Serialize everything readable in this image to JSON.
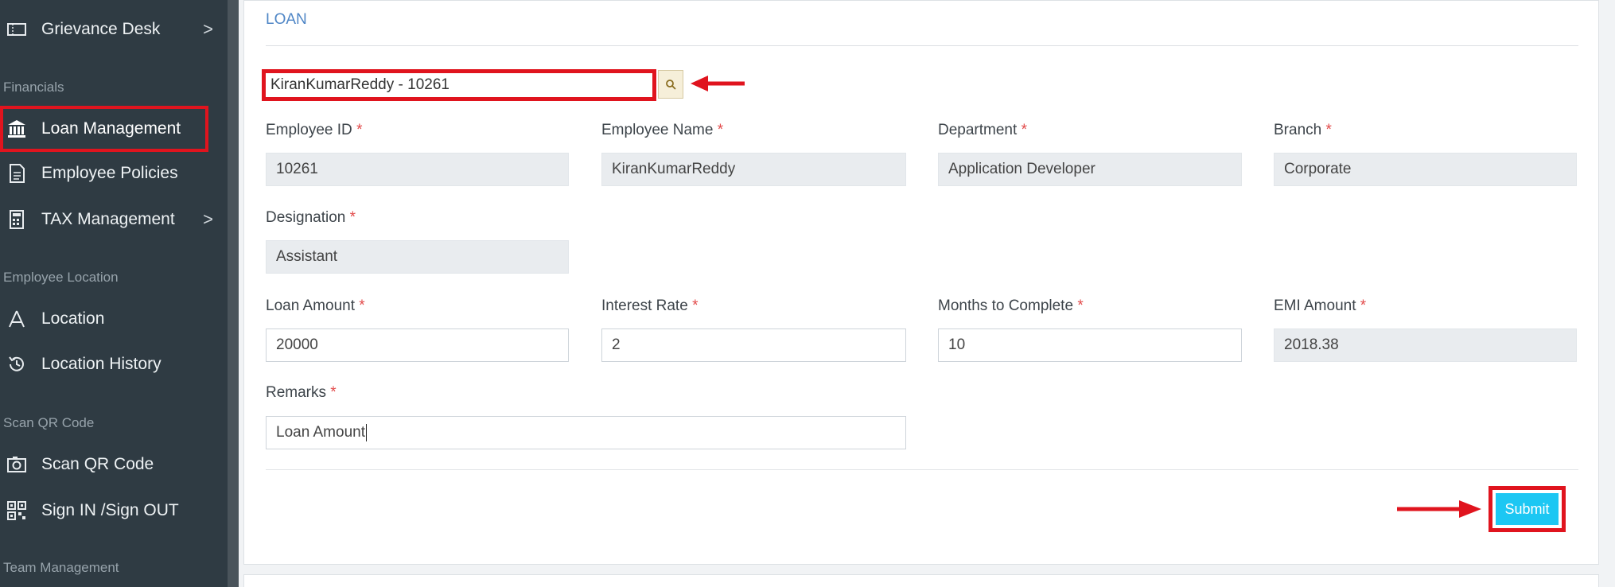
{
  "sidebar": {
    "items": [
      {
        "label": "Grievance Desk",
        "icon": "ticket-icon",
        "chevron": ">"
      },
      {
        "label": "Loan Management",
        "icon": "bank-icon"
      },
      {
        "label": "Employee Policies",
        "icon": "document-icon"
      },
      {
        "label": "TAX Management",
        "icon": "calculator-icon",
        "chevron": ">"
      },
      {
        "label": "Location",
        "icon": "location-icon"
      },
      {
        "label": "Location History",
        "icon": "history-icon"
      },
      {
        "label": "Scan QR Code",
        "icon": "camera-icon"
      },
      {
        "label": "Sign IN /Sign OUT",
        "icon": "qr-code-icon"
      }
    ],
    "sections": [
      "Financials",
      "Employee Location",
      "Scan QR Code",
      "Team Management"
    ]
  },
  "card": {
    "title": "LOAN"
  },
  "search": {
    "value": "KiranKumarReddy - 10261",
    "icon": "search-icon"
  },
  "form": {
    "required_mark": "*",
    "employee_id": {
      "label": "Employee ID",
      "value": "10261"
    },
    "employee_name": {
      "label": "Employee Name",
      "value": "KiranKumarReddy"
    },
    "department": {
      "label": "Department",
      "value": "Application Developer"
    },
    "branch": {
      "label": "Branch",
      "value": "Corporate"
    },
    "designation": {
      "label": "Designation",
      "value": "Assistant"
    },
    "loan_amount": {
      "label": "Loan Amount",
      "value": "20000"
    },
    "interest_rate": {
      "label": "Interest Rate",
      "value": "2"
    },
    "months": {
      "label": "Months to Complete",
      "value": "10"
    },
    "emi_amount": {
      "label": "EMI Amount",
      "value": "2018.38"
    },
    "remarks": {
      "label": "Remarks",
      "value": "Loan Amount"
    }
  },
  "submit_label": "Submit",
  "colors": {
    "sidebar_bg": "#2f3b43",
    "highlight_red": "#e0141e",
    "submit_cyan": "#1cc7f3",
    "title_blue": "#4f86c6"
  }
}
